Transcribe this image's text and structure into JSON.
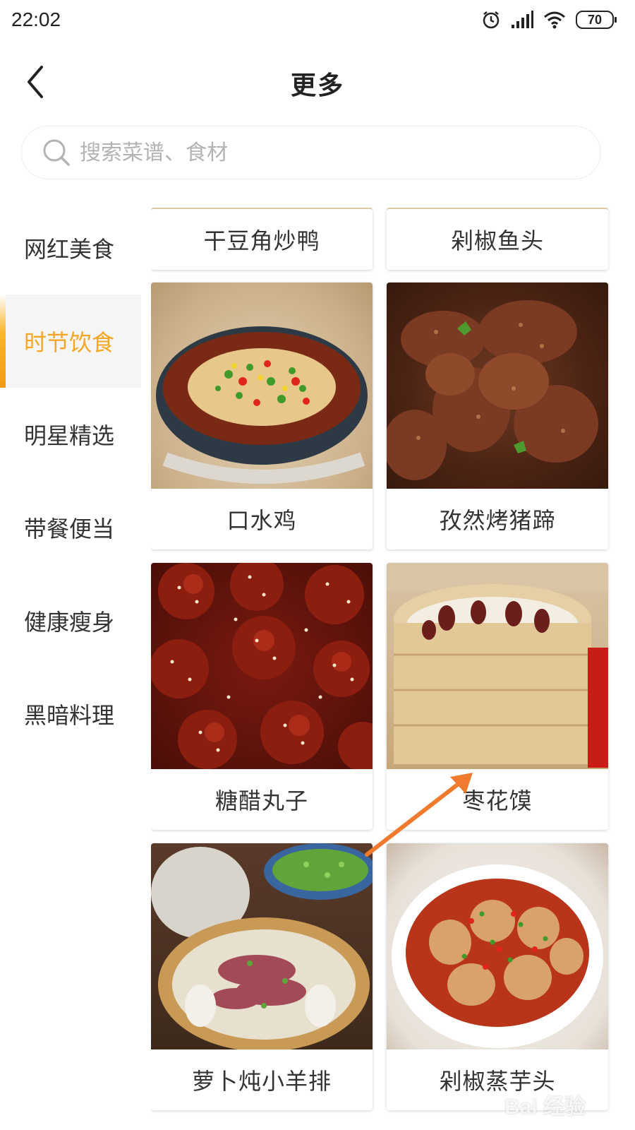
{
  "status_bar": {
    "time": "22:02",
    "battery": "70",
    "icons": [
      "alarm-icon",
      "signal-icon",
      "wifi-icon",
      "battery-icon"
    ]
  },
  "header": {
    "title": "更多",
    "back_icon": "chevron-left-icon"
  },
  "search": {
    "placeholder": "搜索菜谱、食材",
    "value": ""
  },
  "sidebar": {
    "items": [
      {
        "label": "网红美食",
        "active": false
      },
      {
        "label": "时节饮食",
        "active": true
      },
      {
        "label": "明星精选",
        "active": false
      },
      {
        "label": "带餐便当",
        "active": false
      },
      {
        "label": "健康瘦身",
        "active": false
      },
      {
        "label": "黑暗料理",
        "active": false
      }
    ]
  },
  "recipes": [
    {
      "name": "干豆角炒鸭"
    },
    {
      "name": "剁椒鱼头"
    },
    {
      "name": "口水鸡"
    },
    {
      "name": "孜然烤猪蹄"
    },
    {
      "name": "糖醋丸子"
    },
    {
      "name": "枣花馍"
    },
    {
      "name": "萝卜炖小羊排"
    },
    {
      "name": "剁椒蒸芋头"
    }
  ],
  "watermark": "Bai 经验",
  "colors": {
    "accent": "#f5a623",
    "arrow": "#f07a2e"
  }
}
